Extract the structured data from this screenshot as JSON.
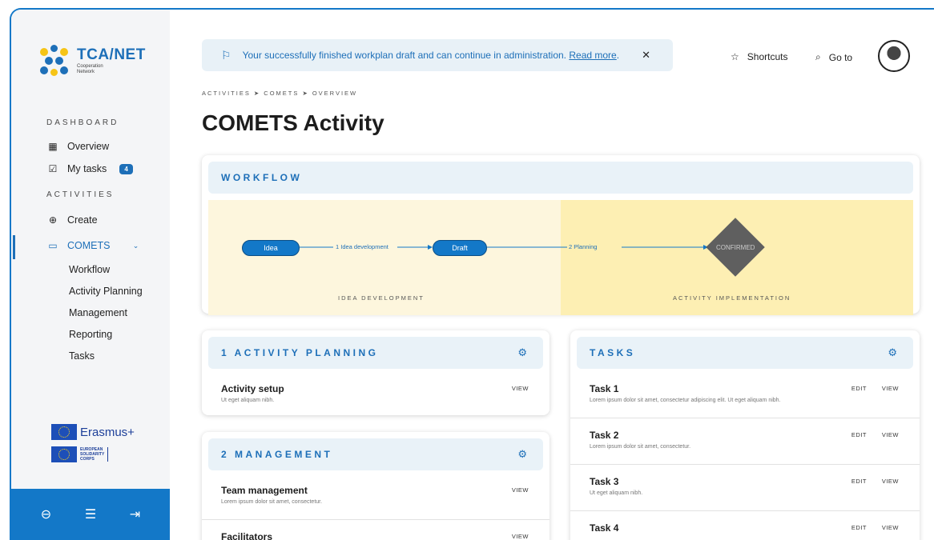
{
  "brand": {
    "title": "TCA/NET",
    "subtitle_line1": "Cooperation",
    "subtitle_line2": "Network"
  },
  "sidebar": {
    "section_dashboard": "DASHBOARD",
    "overview": "Overview",
    "my_tasks": "My tasks",
    "my_tasks_count": "4",
    "section_activities": "ACTIVITIES",
    "create": "Create",
    "comets": "COMETS",
    "sub_items": [
      "Workflow",
      "Activity Planning",
      "Management",
      "Reporting",
      "Tasks"
    ],
    "erasmus_label": "Erasmus+",
    "esc_line1": "EUROPEAN",
    "esc_line2": "SOLIDARITY",
    "esc_line3": "CORPS"
  },
  "notice": {
    "text": "Your successfully finished workplan draft and can continue in administration.",
    "link": "Read more",
    "after_link": "."
  },
  "topbar": {
    "shortcuts": "Shortcuts",
    "goto": "Go to"
  },
  "breadcrumb": "ACTIVITIES ➤ COMETS ➤ OVERVIEW",
  "page_title": "COMETS Activity",
  "workflow": {
    "title": "WORKFLOW",
    "nodes": {
      "idea": "Idea",
      "draft": "Draft",
      "confirmed": "CONFIRMED"
    },
    "edges": {
      "e1": "1 Idea development",
      "e2": "2 Planning"
    },
    "lanes": {
      "left": "IDEA DEVELOPMENT",
      "right": "ACTIVITY IMPLEMENTATION"
    }
  },
  "planning": {
    "title": "1 ACTIVITY PLANNING",
    "rows": [
      {
        "title": "Activity setup",
        "desc": "Ut eget aliquam nibh.",
        "view": "VIEW"
      }
    ]
  },
  "management": {
    "title": "2 MANAGEMENT",
    "rows": [
      {
        "title": "Team management",
        "desc": "Lorem ipsum dolor sit amet, consectetur.",
        "view": "VIEW"
      },
      {
        "title": "Facilitators",
        "view": "VIEW"
      }
    ]
  },
  "tasks": {
    "title": "TASKS",
    "rows": [
      {
        "title": "Task 1",
        "desc": "Lorem ipsum dolor sit amet, consectetur adipiscing elit. Ut eget aliquam nibh.",
        "edit": "EDIT",
        "view": "VIEW"
      },
      {
        "title": "Task 2",
        "desc": "Lorem ipsum dolor sit amet, consectetur.",
        "edit": "EDIT",
        "view": "VIEW"
      },
      {
        "title": "Task 3",
        "desc": "Ut eget aliquam nibh.",
        "edit": "EDIT",
        "view": "VIEW"
      },
      {
        "title": "Task 4",
        "edit": "EDIT",
        "view": "VIEW"
      }
    ]
  }
}
